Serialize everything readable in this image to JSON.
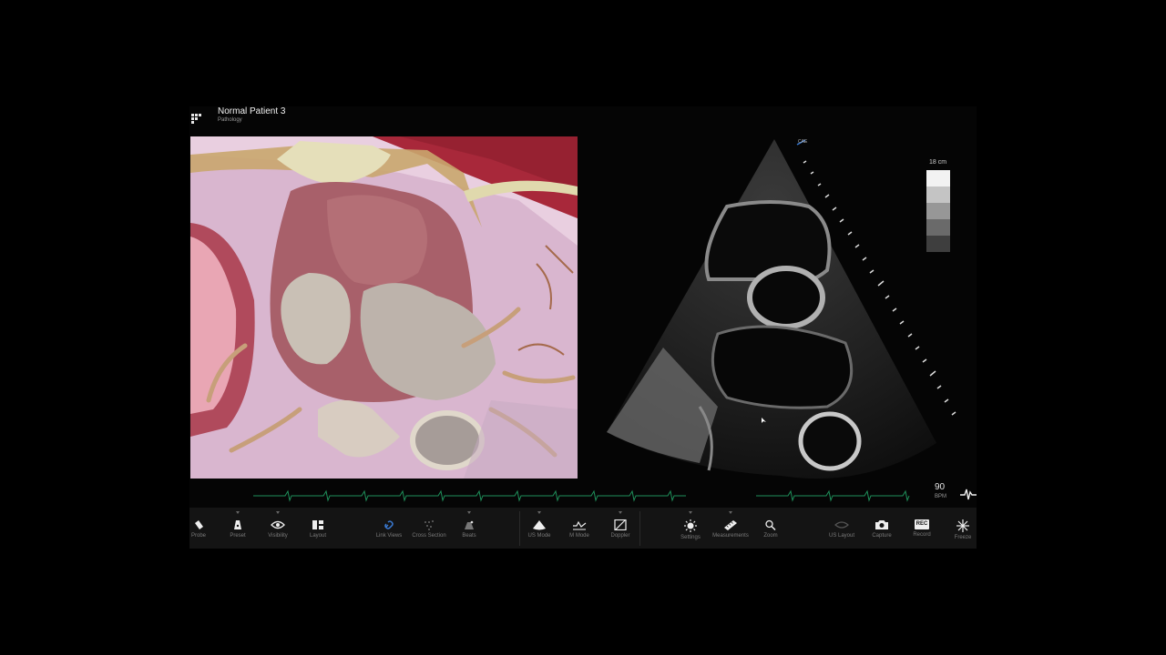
{
  "header": {
    "title": "Normal Patient 3",
    "subtitle": "Pathology"
  },
  "ultrasound": {
    "depth_label": "18 cm",
    "brand_mark": "CAE"
  },
  "vitals": {
    "bpm_value": "90",
    "bpm_unit": "BPM"
  },
  "toolbar": {
    "probe": "Probe",
    "preset": "Preset",
    "visibility": "Visibility",
    "layout": "Layout",
    "link_views": "Link Views",
    "cross_section": "Cross Section",
    "beats": "Beats",
    "us_mode": "US Mode",
    "m_mode": "M Mode",
    "doppler": "Doppler",
    "settings": "Settings",
    "measurements": "Measurements",
    "zoom": "Zoom",
    "us_layout": "US Layout",
    "capture": "Capture",
    "record": "Record",
    "freeze": "Freeze",
    "record_badge": "REC"
  },
  "colors": {
    "accent_blue": "#3a7bd5",
    "ecg_green": "#1f8f5a",
    "toolbar_bg": "#141414"
  }
}
